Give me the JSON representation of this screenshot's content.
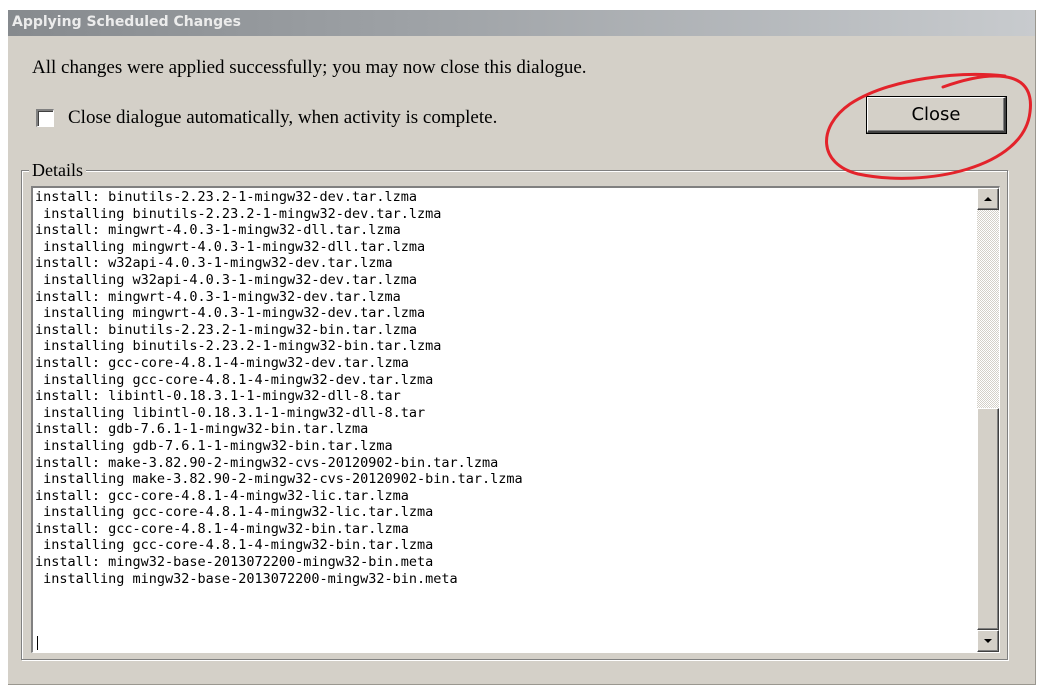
{
  "window": {
    "title": "Applying Scheduled Changes"
  },
  "message": "All changes were applied successfully; you may now close this dialogue.",
  "auto_close": {
    "label": "Close dialogue automatically, when activity is complete.",
    "checked": false
  },
  "close_button": {
    "label": "Close"
  },
  "annotation": {
    "color": "#e3232b"
  },
  "details": {
    "label": "Details",
    "lines": [
      "install: binutils-2.23.2-1-mingw32-dev.tar.lzma",
      " installing binutils-2.23.2-1-mingw32-dev.tar.lzma",
      "install: mingwrt-4.0.3-1-mingw32-dll.tar.lzma",
      " installing mingwrt-4.0.3-1-mingw32-dll.tar.lzma",
      "install: w32api-4.0.3-1-mingw32-dev.tar.lzma",
      " installing w32api-4.0.3-1-mingw32-dev.tar.lzma",
      "install: mingwrt-4.0.3-1-mingw32-dev.tar.lzma",
      " installing mingwrt-4.0.3-1-mingw32-dev.tar.lzma",
      "install: binutils-2.23.2-1-mingw32-bin.tar.lzma",
      " installing binutils-2.23.2-1-mingw32-bin.tar.lzma",
      "install: gcc-core-4.8.1-4-mingw32-dev.tar.lzma",
      " installing gcc-core-4.8.1-4-mingw32-dev.tar.lzma",
      "install: libintl-0.18.3.1-1-mingw32-dll-8.tar",
      " installing libintl-0.18.3.1-1-mingw32-dll-8.tar",
      "install: gdb-7.6.1-1-mingw32-bin.tar.lzma",
      " installing gdb-7.6.1-1-mingw32-bin.tar.lzma",
      "install: make-3.82.90-2-mingw32-cvs-20120902-bin.tar.lzma",
      " installing make-3.82.90-2-mingw32-cvs-20120902-bin.tar.lzma",
      "install: gcc-core-4.8.1-4-mingw32-lic.tar.lzma",
      " installing gcc-core-4.8.1-4-mingw32-lic.tar.lzma",
      "install: gcc-core-4.8.1-4-mingw32-bin.tar.lzma",
      " installing gcc-core-4.8.1-4-mingw32-bin.tar.lzma",
      "install: mingw32-base-2013072200-mingw32-bin.meta",
      " installing mingw32-base-2013072200-mingw32-bin.meta"
    ]
  },
  "scrollbar": {
    "up_icon": "scroll-up-arrow",
    "down_icon": "scroll-down-arrow",
    "position": 1.0
  }
}
